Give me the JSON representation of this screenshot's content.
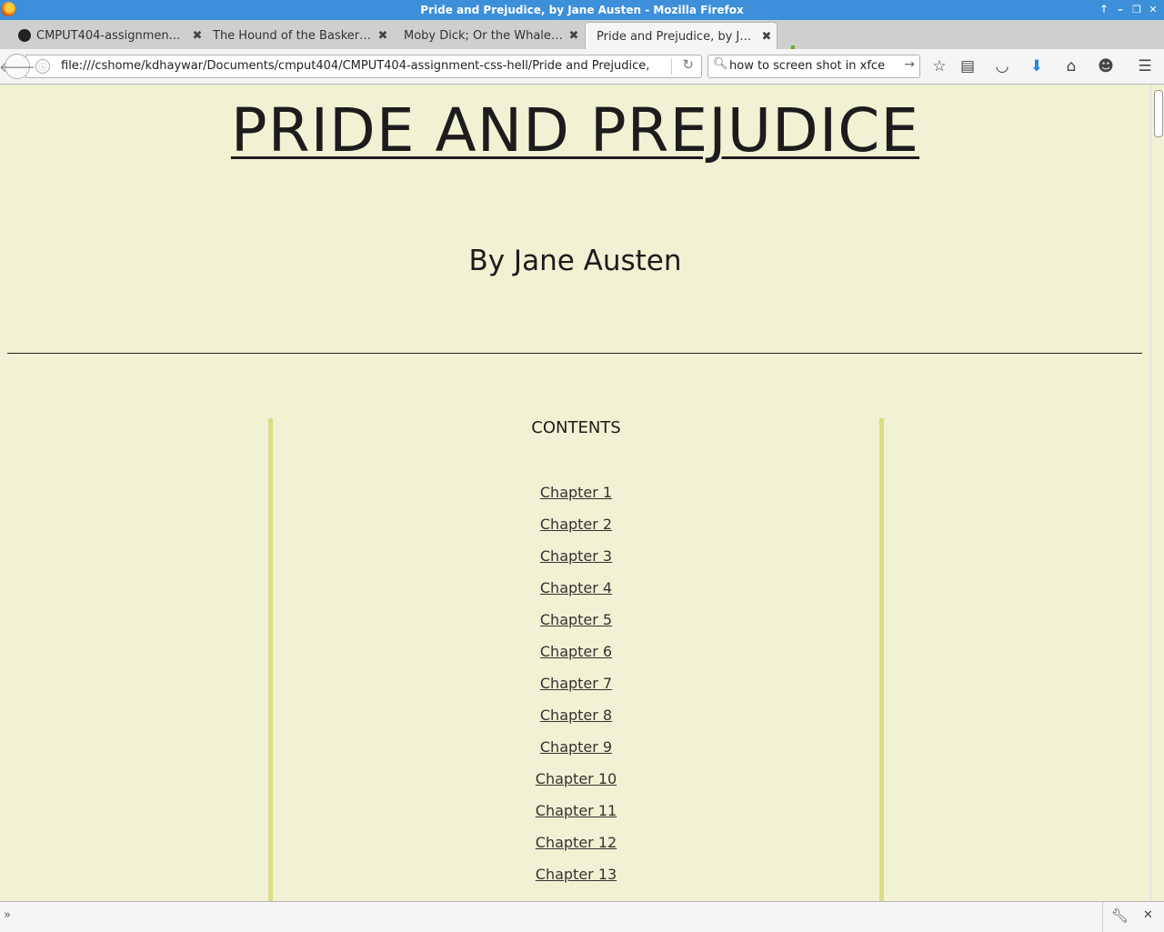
{
  "window": {
    "title": "Pride and Prejudice, by Jane Austen - Mozilla Firefox",
    "controls": {
      "up": "🡑",
      "minimize": "–",
      "restore": "❐",
      "close": "✕"
    }
  },
  "tabs": [
    {
      "label": "CMPUT404-assignmen..."
    },
    {
      "label": "The Hound of the Baskerv..."
    },
    {
      "label": "Moby Dick; Or the Whale, ..."
    },
    {
      "label": "Pride and Prejudice, by Ja..."
    }
  ],
  "navbar": {
    "url": "file:///cshome/kdhaywar/Documents/cmput404/CMPUT404-assignment-css-hell/Pride and Prejudice, by Ja",
    "search_value": "how to screen shot in xfce"
  },
  "page": {
    "title": "PRIDE AND PREJUDICE",
    "author": "By Jane Austen",
    "contents_heading": "CONTENTS",
    "chapters": [
      "Chapter 1",
      "Chapter 2",
      "Chapter 3",
      "Chapter 4",
      "Chapter 5",
      "Chapter 6",
      "Chapter 7",
      "Chapter 8",
      "Chapter 9",
      "Chapter 10",
      "Chapter 11",
      "Chapter 12",
      "Chapter 13"
    ]
  },
  "colors": {
    "page_background": "#f1f1d4",
    "contents_border": "#dcdc87",
    "titlebar": "#3c8fd8"
  },
  "icons": {
    "back": "arrow-left-icon",
    "reload": "reload-icon",
    "bookmark": "star-icon",
    "reading_list": "clipboard-icon",
    "pocket": "pocket-icon",
    "downloads": "download-arrow-icon",
    "home": "home-icon",
    "hello": "chat-icon",
    "menu": "hamburger-menu-icon"
  }
}
